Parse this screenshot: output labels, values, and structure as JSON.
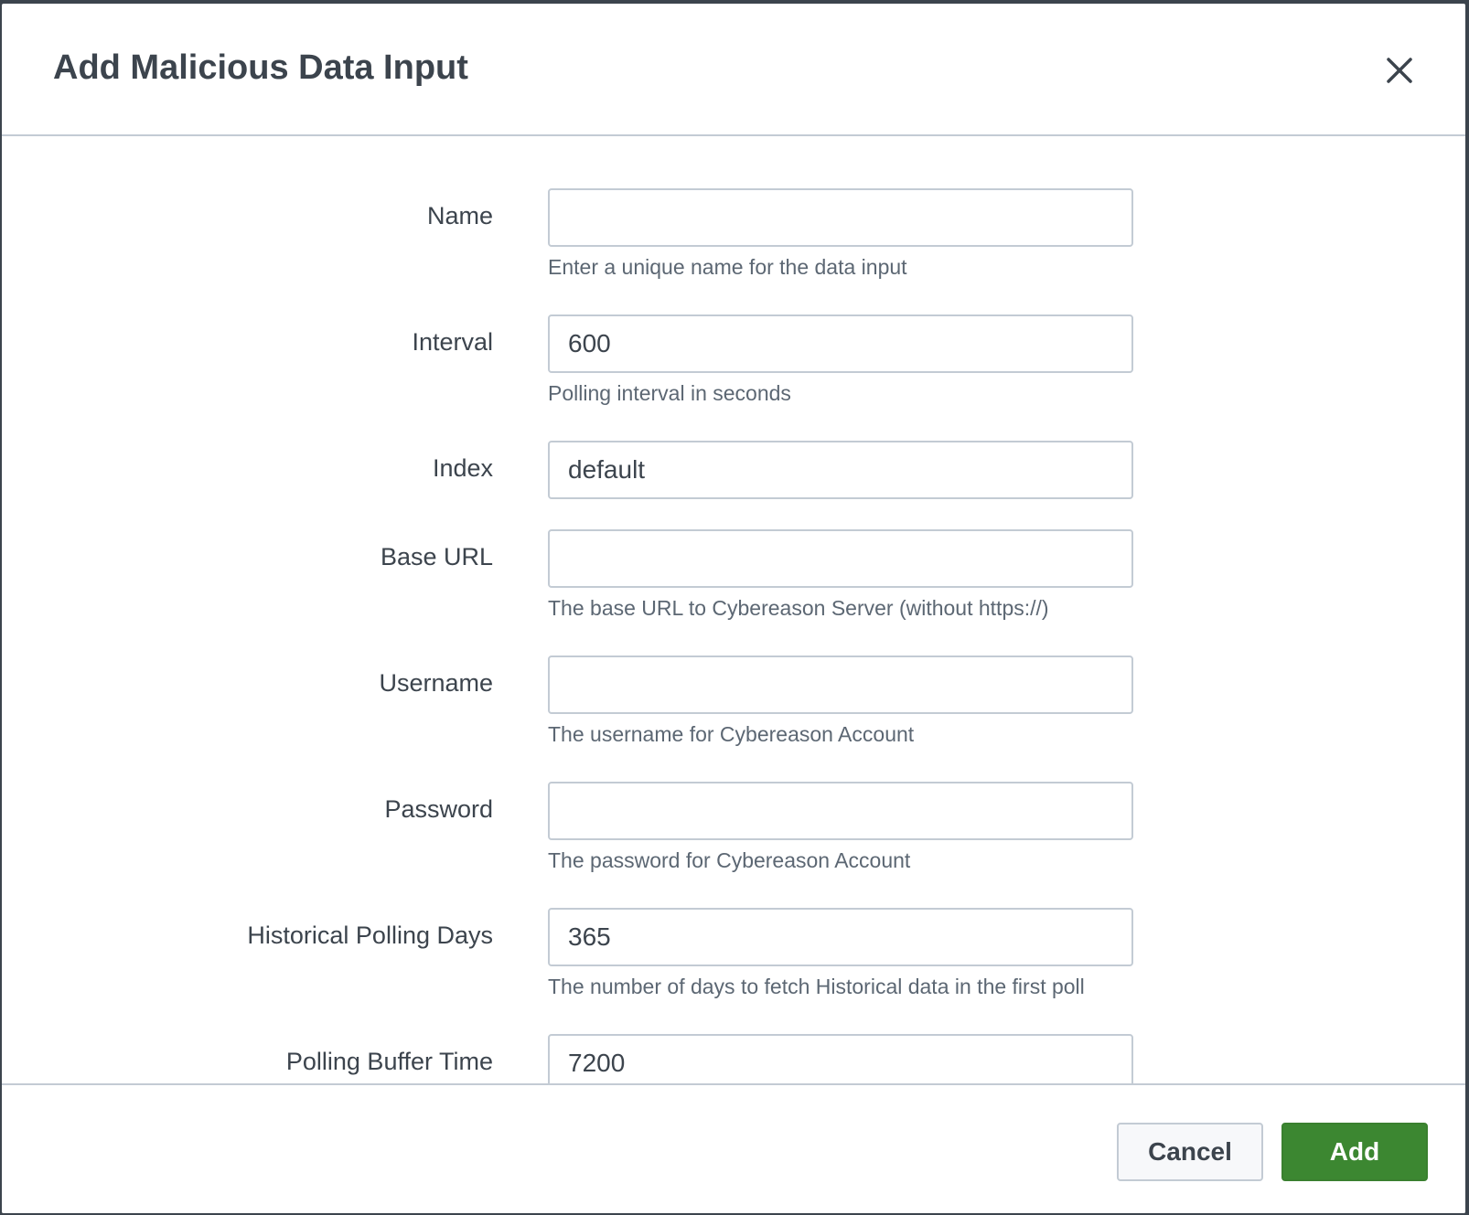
{
  "dialog": {
    "title": "Add Malicious Data Input",
    "close_icon": "close-icon"
  },
  "fields": {
    "name": {
      "label": "Name",
      "value": "",
      "help": "Enter a unique name for the data input"
    },
    "interval": {
      "label": "Interval",
      "value": "600",
      "help": "Polling interval in seconds"
    },
    "index": {
      "label": "Index",
      "value": "default"
    },
    "base_url": {
      "label": "Base URL",
      "value": "",
      "help": "The base URL to Cybereason Server (without https://)"
    },
    "username": {
      "label": "Username",
      "value": "",
      "help": "The username for Cybereason Account"
    },
    "password": {
      "label": "Password",
      "value": "",
      "help": "The password for Cybereason Account"
    },
    "historical_polling_days": {
      "label": "Historical Polling Days",
      "value": "365",
      "help": "The number of days to fetch Historical data in the first poll"
    },
    "polling_buffer_time": {
      "label": "Polling Buffer Time",
      "value": "7200"
    }
  },
  "footer": {
    "cancel_label": "Cancel",
    "add_label": "Add"
  },
  "colors": {
    "primary_button": "#3c8731",
    "border": "#c3cbd4",
    "text": "#3c444d",
    "help_text": "#5c6773"
  }
}
